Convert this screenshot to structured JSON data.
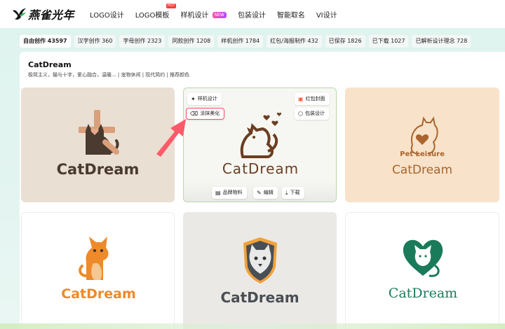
{
  "app": {
    "brand": "燕雀光年",
    "colors": {
      "teal_band": "#dff3ef",
      "accent_red": "#ff4a6a",
      "brand_green": "#1a8a5e"
    }
  },
  "nav": {
    "items": [
      {
        "label": "LOGO设计"
      },
      {
        "label": "LOGO模板",
        "badge": "HOT"
      },
      {
        "label": "样机设计",
        "badge": "NEW"
      },
      {
        "label": "包装设计"
      },
      {
        "label": "智能取名"
      },
      {
        "label": "VI设计"
      }
    ]
  },
  "tabs": [
    "自由创作 43597",
    "汉字创作 360",
    "字母创作 2323",
    "同款创作 1208",
    "样机创作 1784",
    "红包/海报制作 432",
    "已保存 1826",
    "已下载 1027",
    "已解析设计理念 728"
  ],
  "project": {
    "title": "CatDream",
    "subtitle": "极简主义，猫与十字，爱心融合，温暖... | 宠物休闲 | 现代简约 | 推荐颜色"
  },
  "hover_tile": {
    "chips": {
      "mockup": "样机设计",
      "retouch": "涂抹美化",
      "redpacket": "红包封面",
      "packaging": "包装设计"
    },
    "actions": {
      "brand": "品牌物料",
      "edit": "编辑",
      "download": "下载"
    }
  },
  "tiles": [
    {
      "wordmark": "CatDream",
      "icon": "cat-cross-icon"
    },
    {
      "wordmark": "CatDream",
      "icon": "cat-hearts-icon"
    },
    {
      "wordmark": "CatDream",
      "tagline": "Pet Leisure",
      "icon": "cat-heart-icon"
    },
    {
      "wordmark": "CatDream",
      "icon": "orange-cat-icon"
    },
    {
      "wordmark": "CatDream",
      "icon": "cat-shield-icon"
    },
    {
      "wordmark": "CatDream",
      "icon": "cat-leaf-heart-icon"
    }
  ]
}
